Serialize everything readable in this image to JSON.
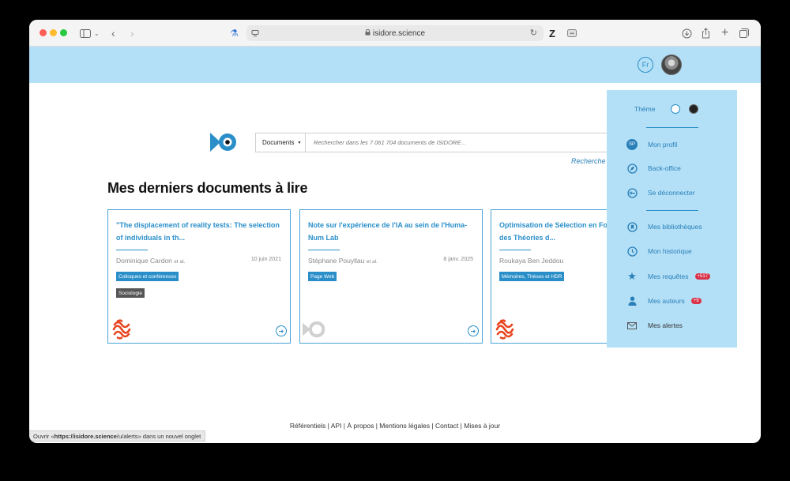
{
  "browser": {
    "url": "isidore.science",
    "status": {
      "prefix": "Ouvrir « ",
      "link": "https://isidore.science",
      "path": "/u/alerts",
      "suffix": " » dans un nouvel onglet"
    }
  },
  "header": {
    "lang": "Fr"
  },
  "search": {
    "select_label": "Documents",
    "placeholder": "Rechercher dans les 7 061 704 documents de ISIDORE...",
    "link_label": "Recherche"
  },
  "section_title": "Mes derniers documents à lire",
  "cards": [
    {
      "title": "\"The displacement of reality tests: The selection of individuals in th...",
      "author": "Dominique Cardon",
      "et_al": "et al.",
      "date": "10 juin 2021",
      "tags": [
        "Colloques et conférences",
        "Sociologie"
      ]
    },
    {
      "title": "Note sur l'expérience de l'IA au sein de l'Huma-Num Lab",
      "author": "Stéphane Pouyllau",
      "et_al": "et al.",
      "date": "8 janv. 2025",
      "tags": [
        "Page Web"
      ]
    },
    {
      "title": "Optimisation de Sélection en Foo... l'Intégration des Théories d...",
      "author": "Roukaya Ben Jeddou",
      "et_al": "",
      "date": "",
      "tags": [
        "Mémoires, Thèses et HDR"
      ]
    }
  ],
  "dropdown": {
    "theme_label": "Thème",
    "items": [
      {
        "label": "Mon profil",
        "icon": "sp-avatar-icon",
        "icon_text": "SP"
      },
      {
        "label": "Back-office",
        "icon": "compass-icon"
      },
      {
        "label": "Se déconnecter",
        "icon": "key-icon"
      },
      {
        "label": "Mes bibliothèques",
        "icon": "bookmark-icon"
      },
      {
        "label": "Mon historique",
        "icon": "clock-icon"
      },
      {
        "label": "Mes requêtes",
        "icon": "star-icon",
        "badge": "+517"
      },
      {
        "label": "Mes auteurs",
        "icon": "person-icon",
        "badge": "+9"
      },
      {
        "label": "Mes alertes",
        "icon": "envelope-icon"
      }
    ]
  },
  "footer": {
    "text": "Référentiels | API | À propos | Mentions légales | Contact | Mises à jour"
  },
  "colors": {
    "accent": "#2a8fc9",
    "header_bg": "#b3e0f7",
    "badge": "#d9334a"
  }
}
